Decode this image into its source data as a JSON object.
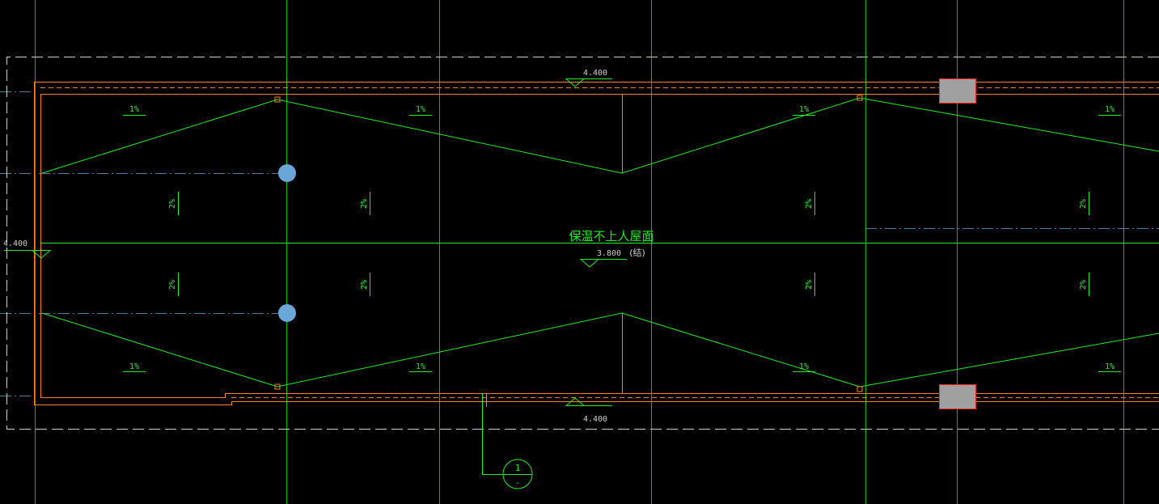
{
  "drawing": {
    "roof_label": "保温不上人屋面",
    "structural_elevation": "3.800",
    "structural_suffix": "(结)",
    "elevation_top": "4.400",
    "elevation_left": "4.400",
    "elevation_bottom": "4.400",
    "slope_1": "1%",
    "slope_2": "2%",
    "section_symbol_top": "1",
    "section_symbol_bottom": "-"
  },
  "colors": {
    "background": "#000000",
    "axis_grid": "#00c000",
    "slope_line": "#22ee22",
    "parapet": "#ff8020",
    "dashed_outline": "#cfcfcf",
    "dashdot_axis": "#4a7fa0",
    "drain": "#6aa6d8",
    "vent_fill": "#a0a0a0",
    "vent_stroke": "#ff2020"
  }
}
